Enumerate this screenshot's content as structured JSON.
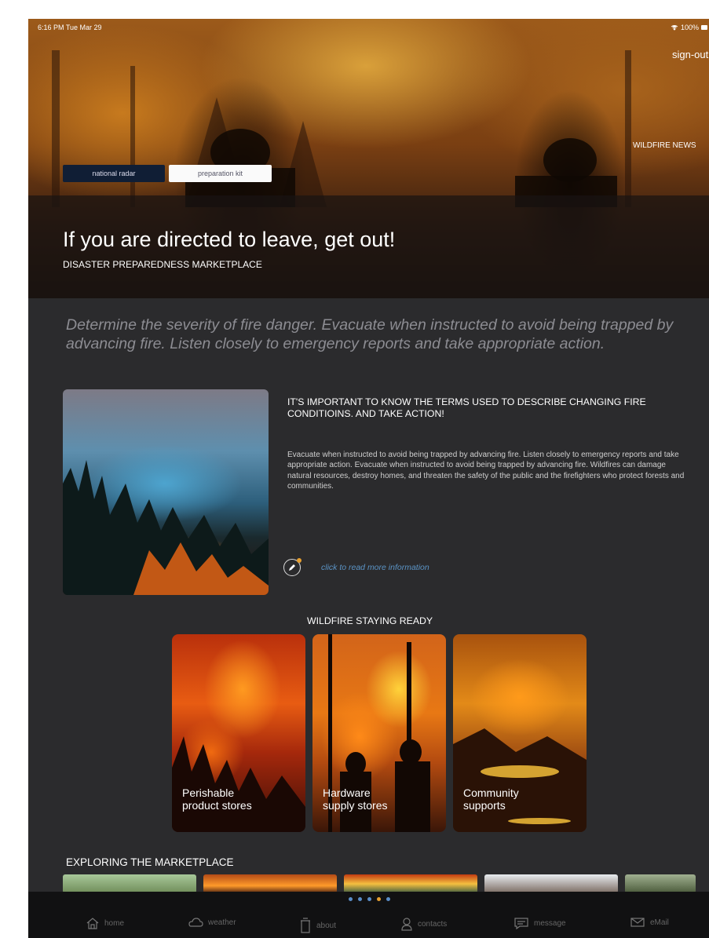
{
  "status_bar": {
    "time": "6:16 PM  Tue Mar 29",
    "wifi_icon": "wifi-icon",
    "battery": "100%"
  },
  "header": {
    "signout_label": "sign-out",
    "news_label": "WILDFIRE NEWS"
  },
  "hero": {
    "buttons": {
      "national_radar": "national radar",
      "preparation_kit": "preparation kit"
    },
    "title": "If you are directed to leave, get out!",
    "subtitle": "DISASTER PREPAREDNESS MARKETPLACE"
  },
  "intro": "Determine the severity of fire danger. Evacuate when instructed to avoid being trapped by advancing fire. Listen closely to emergency reports and take appropriate action.",
  "feature": {
    "title": "IT'S IMPORTANT TO KNOW THE TERMS USED TO DESCRIBE CHANGING FIRE CONDITIOINS. AND TAKE ACTION!",
    "body": "Evacuate when instructed to avoid being trapped by advancing fire. Listen closely to emergency reports and take appropriate action. Evacuate when instructed to avoid being trapped by advancing fire. Wildfires can damage natural resources, destroy homes, and threaten the safety of the public and the firefighters who protect forests and communities.",
    "read_more": "click to read more information"
  },
  "staying_ready": {
    "title": "WILDFIRE STAYING READY",
    "cards": [
      {
        "line1": "Perishable",
        "line2": "product stores"
      },
      {
        "line1": "Hardware",
        "line2": "supply stores"
      },
      {
        "line1": "Community",
        "line2": "supports"
      }
    ]
  },
  "marketplace": {
    "title": "EXPLORING THE MARKETPLACE"
  },
  "pager": {
    "count": 5,
    "active_index": 3,
    "colors": {
      "inactive": "#5a8ec9",
      "active": "#e8a030"
    }
  },
  "tabs": [
    {
      "label": "home",
      "icon": "home-icon"
    },
    {
      "label": "weather",
      "icon": "cloud-icon"
    },
    {
      "label": "about",
      "icon": "trash-icon"
    },
    {
      "label": "contacts",
      "icon": "person-icon"
    },
    {
      "label": "message",
      "icon": "message-icon"
    },
    {
      "label": "eMail",
      "icon": "mail-icon"
    }
  ]
}
